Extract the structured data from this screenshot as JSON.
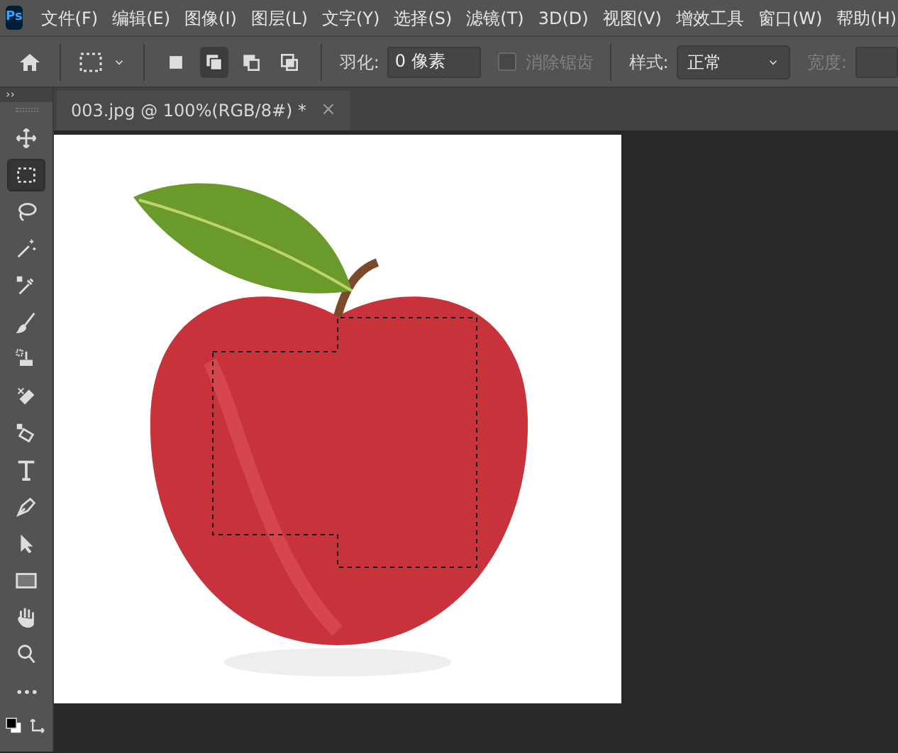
{
  "app": {
    "logo": "Ps"
  },
  "menu": [
    "文件(F)",
    "编辑(E)",
    "图像(I)",
    "图层(L)",
    "文字(Y)",
    "选择(S)",
    "滤镜(T)",
    "3D(D)",
    "视图(V)",
    "增效工具",
    "窗口(W)",
    "帮助(H)"
  ],
  "options_bar": {
    "selection_modes": [
      {
        "kind": "new",
        "selected": false
      },
      {
        "kind": "add",
        "selected": true
      },
      {
        "kind": "subtract",
        "selected": false
      },
      {
        "kind": "intersect",
        "selected": false
      }
    ],
    "feather": {
      "label": "羽化:",
      "value": "0 像素"
    },
    "antialias": {
      "label": "消除锯齿",
      "checked": false,
      "disabled": true
    },
    "style": {
      "label": "样式:",
      "value": "正常"
    },
    "width": {
      "label": "宽度:"
    }
  },
  "panel_toggle": "››",
  "document_tab": {
    "title": "003.jpg @ 100%(RGB/8#) *",
    "close": "×"
  },
  "tools": [
    {
      "kind": "move",
      "selected": false
    },
    {
      "kind": "marquee",
      "selected": true
    },
    {
      "kind": "lasso",
      "selected": false
    },
    {
      "kind": "wand",
      "selected": false
    },
    {
      "kind": "eyedropper",
      "selected": false
    },
    {
      "kind": "brush",
      "selected": false
    },
    {
      "kind": "stamp",
      "selected": false
    },
    {
      "kind": "eraser",
      "selected": false
    },
    {
      "kind": "bucket",
      "selected": false
    },
    {
      "kind": "type",
      "selected": false
    },
    {
      "kind": "pen",
      "selected": false
    },
    {
      "kind": "pointer",
      "selected": false
    },
    {
      "kind": "rectangle",
      "selected": false
    },
    {
      "kind": "hand",
      "selected": false
    },
    {
      "kind": "zoom",
      "selected": false
    },
    {
      "kind": "more",
      "selected": false
    }
  ]
}
